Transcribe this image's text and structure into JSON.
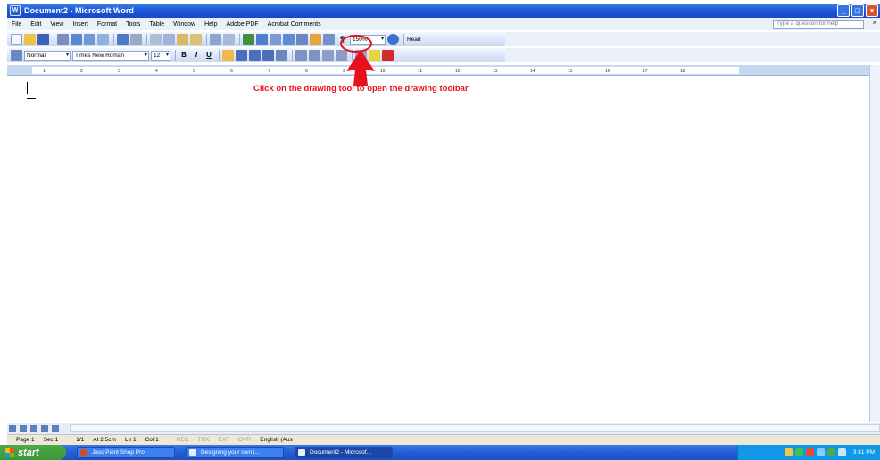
{
  "window": {
    "title": "Document2 - Microsoft Word"
  },
  "menu": {
    "items": [
      "File",
      "Edit",
      "View",
      "Insert",
      "Format",
      "Tools",
      "Table",
      "Window",
      "Help",
      "Adobe PDF",
      "Acrobat Comments"
    ],
    "help_placeholder": "Type a question for help"
  },
  "standard_toolbar": {
    "zoom": "150%",
    "read_label": "Read"
  },
  "format_toolbar": {
    "style": "Normal",
    "font": "Times New Roman",
    "size": "12",
    "bold": "B",
    "italic": "I",
    "underline": "U"
  },
  "ruler": {
    "ticks": [
      "1",
      "2",
      "3",
      "4",
      "5",
      "6",
      "7",
      "8",
      "9",
      "10",
      "11",
      "12",
      "13",
      "14",
      "15",
      "16",
      "17",
      "18"
    ]
  },
  "annotation": {
    "text": "Click on the drawing tool to open the drawing toolbar"
  },
  "status": {
    "page": "Page 1",
    "sec": "Sec 1",
    "pages": "1/1",
    "at": "At 2.5cm",
    "ln": "Ln 1",
    "col": "Col 1",
    "rec": "REC",
    "trk": "TRK",
    "ext": "EXT",
    "ovr": "OVR",
    "language": "English (Aus"
  },
  "taskbar": {
    "start": "start",
    "tasks": [
      "Jasc Paint Shop Pro",
      "Designing your own i...",
      "Document2 - Microsof..."
    ],
    "clock": "3:41 PM"
  },
  "colors": {
    "annotation": "#e8101a",
    "title_bar": "#1d5ad8",
    "taskbar": "#245dd3",
    "start": "#3a9638"
  }
}
